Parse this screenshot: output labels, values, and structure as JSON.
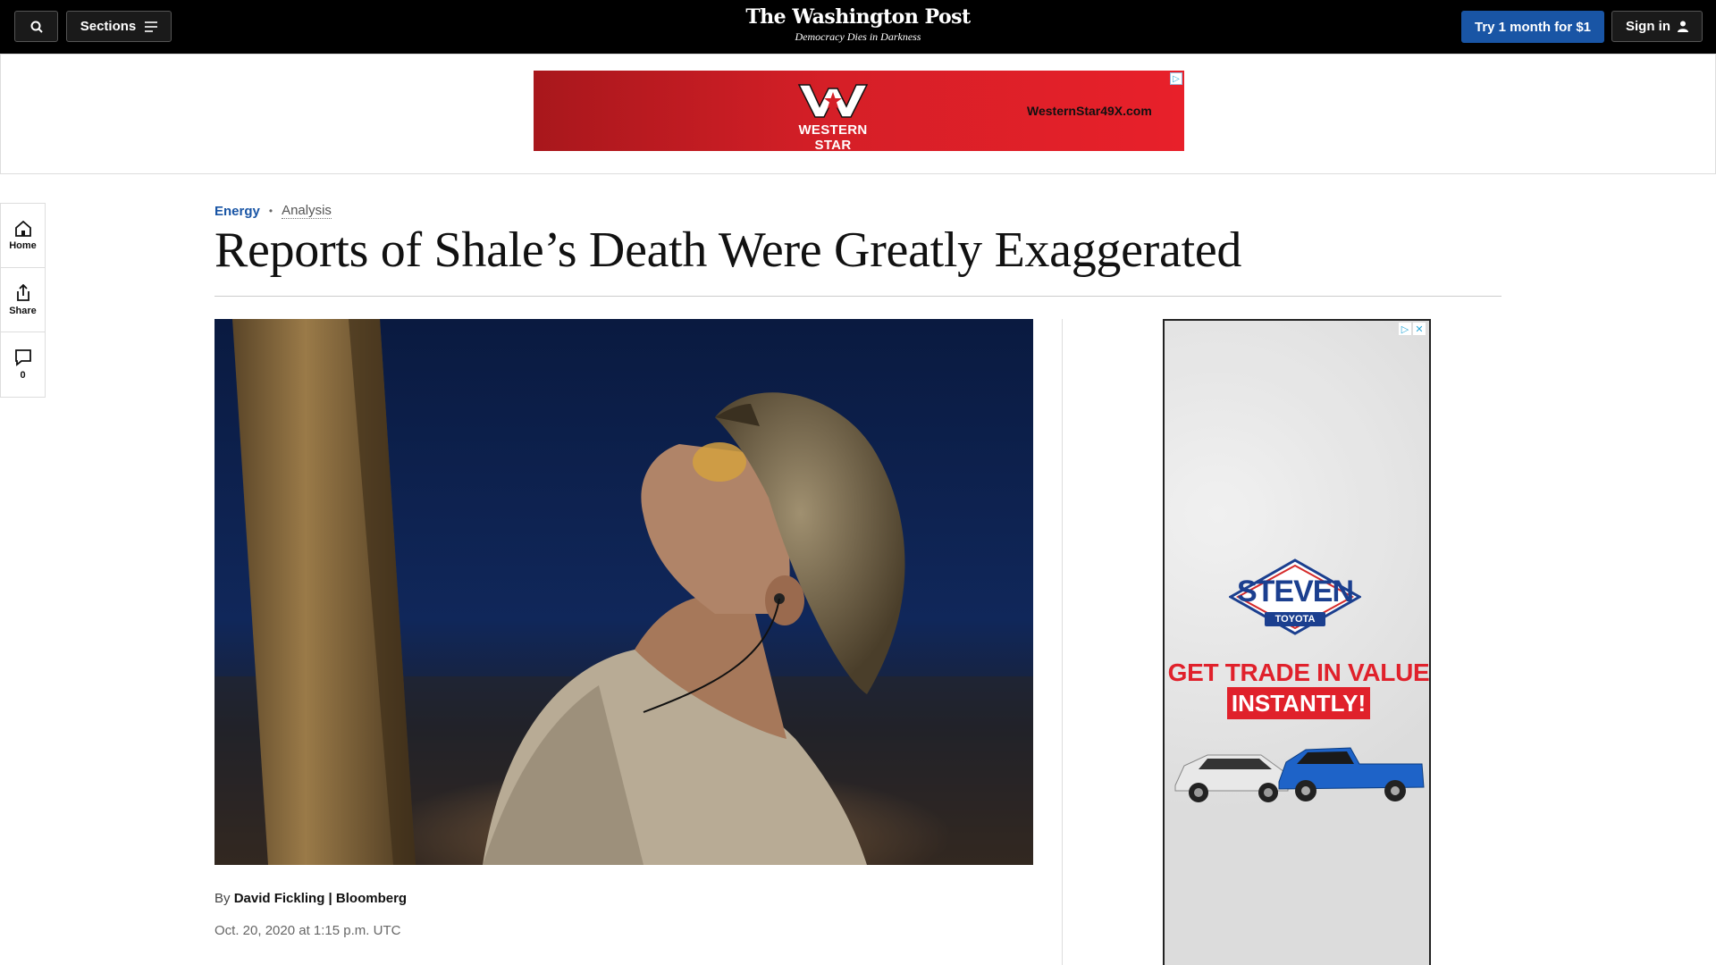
{
  "header": {
    "sections_label": "Sections",
    "logo_title": "The Washington Post",
    "logo_tagline": "Democracy Dies in Darkness",
    "subscribe_label": "Try 1 month for $1",
    "signin_label": "Sign in"
  },
  "top_ad": {
    "brand": "WESTERN STAR",
    "url": "WesternStar49X.com"
  },
  "rail": {
    "home_label": "Home",
    "share_label": "Share",
    "comments_count": "0"
  },
  "article": {
    "category": "Energy",
    "label": "Analysis",
    "headline": "Reports of Shale’s Death Were Greatly Exaggerated",
    "byline_prefix": "By",
    "author": "David Fickling | Bloomberg",
    "date": "Oct. 20, 2020 at 1:15 p.m. UTC"
  },
  "side_ad": {
    "brand": "STEVEN",
    "sub_brand": "TOYOTA",
    "headline_line1": "GET TRADE IN VALUE",
    "headline_line2": "INSTANTLY!"
  },
  "colors": {
    "topbar": "#000000",
    "accent_blue": "#1955a5",
    "ad_red": "#e0212b"
  }
}
